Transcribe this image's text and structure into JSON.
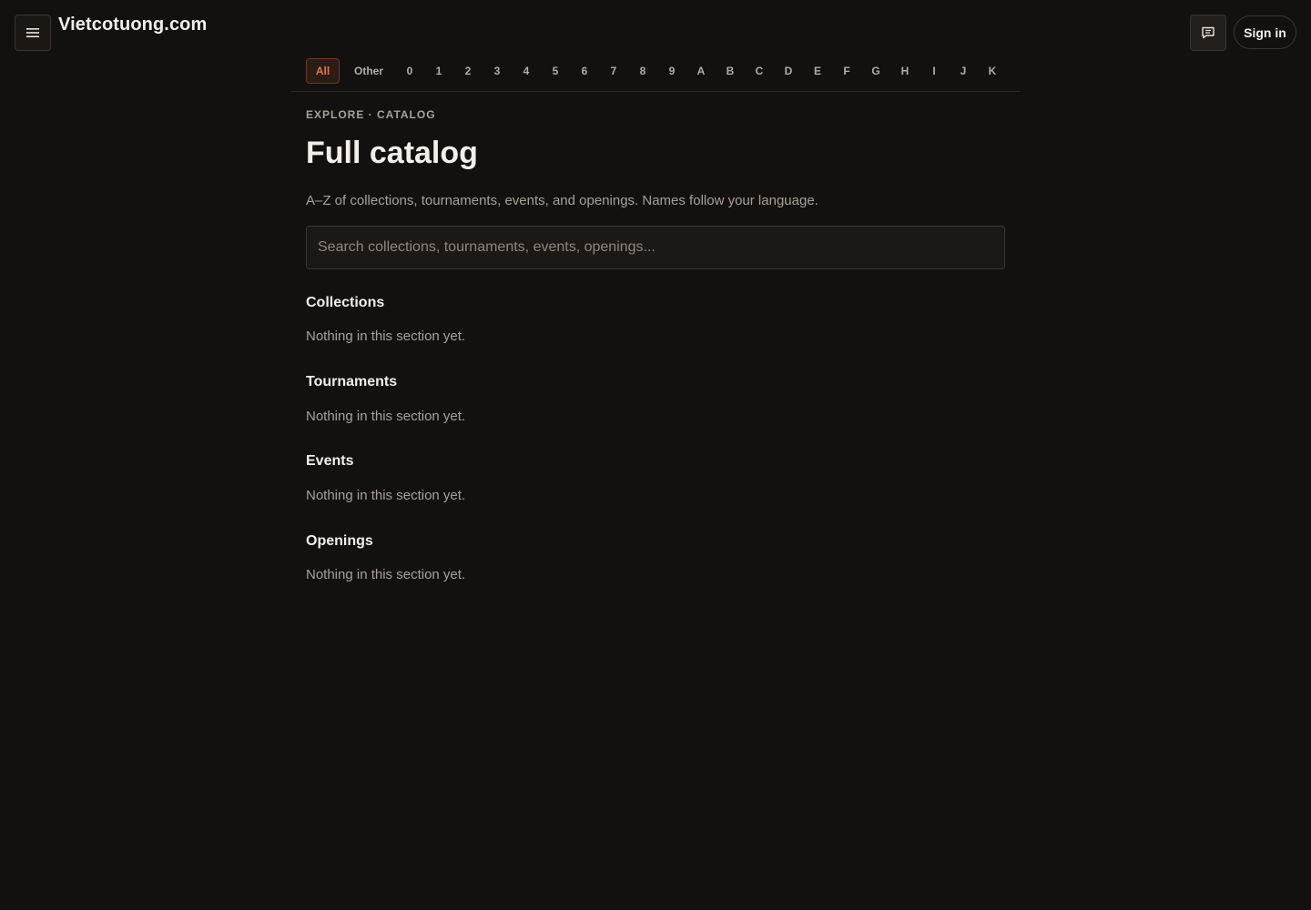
{
  "header": {
    "brand": "Vietcotuong.com",
    "menu_icon": "hamburger-icon",
    "chat_icon": "chat-icon",
    "signin_label": "Sign in"
  },
  "az_filter": {
    "active": "All",
    "items": [
      "All",
      "Other",
      "0",
      "1",
      "2",
      "3",
      "4",
      "5",
      "6",
      "7",
      "8",
      "9",
      "A",
      "B",
      "C",
      "D",
      "E",
      "F",
      "G",
      "H",
      "I",
      "J",
      "K"
    ]
  },
  "page": {
    "eyebrow": "EXPLORE · CATALOG",
    "title": "Full catalog",
    "subtitle": "A–Z of collections, tournaments, events, and openings. Names follow your language."
  },
  "search": {
    "placeholder": "Search collections, tournaments, events, openings...",
    "value": ""
  },
  "sections": [
    {
      "heading": "Collections",
      "empty_text": "Nothing in this section yet."
    },
    {
      "heading": "Tournaments",
      "empty_text": "Nothing in this section yet."
    },
    {
      "heading": "Events",
      "empty_text": "Nothing in this section yet."
    },
    {
      "heading": "Openings",
      "empty_text": "Nothing in this section yet."
    }
  ],
  "colors": {
    "background": "#131110",
    "accent": "#e2774a",
    "text_primary": "#f3eee8",
    "text_muted": "#a9a099"
  }
}
